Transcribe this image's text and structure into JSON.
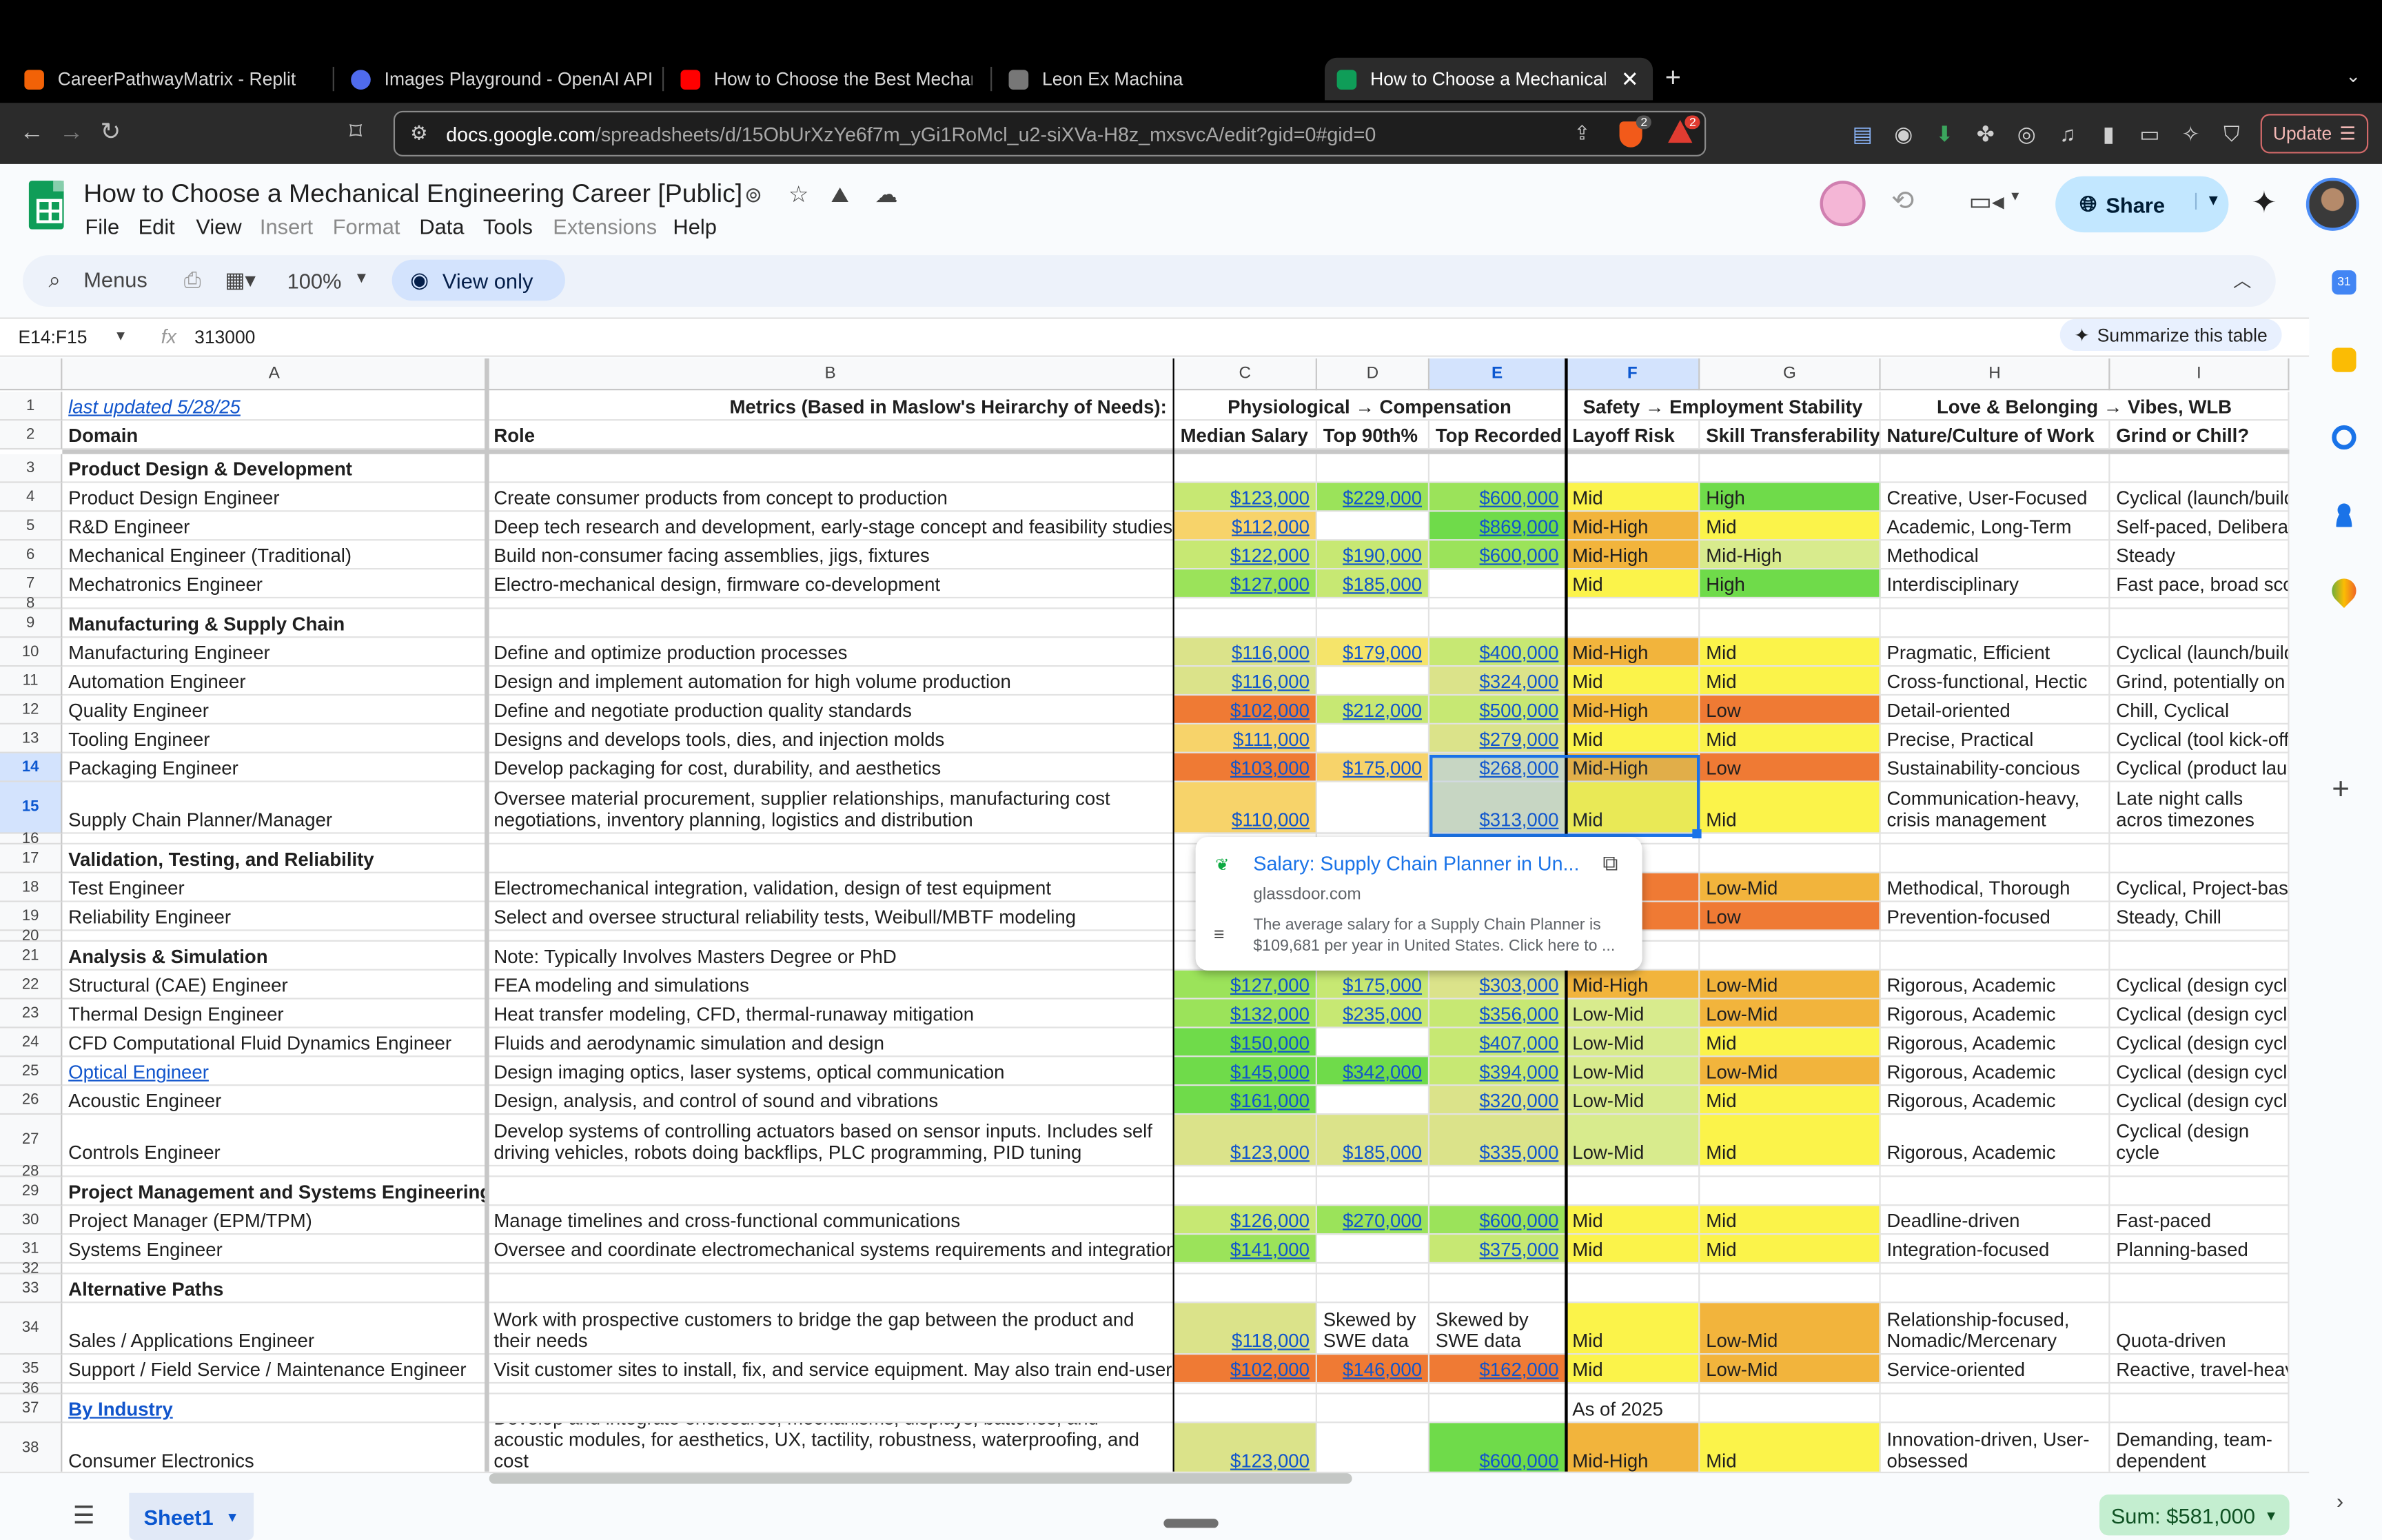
{
  "browser": {
    "tabs": [
      {
        "label": "CareerPathwayMatrix - Replit",
        "color": "#f26207"
      },
      {
        "label": "Images Playground - OpenAI API",
        "color": "#4f6bed"
      },
      {
        "label": "How to Choose the Best Mechani",
        "color": "#ff0000"
      },
      {
        "label": "Leon Ex Machina",
        "color": "#777777"
      },
      {
        "label": "How to Choose a Mechanical",
        "color": "#0f9d58"
      }
    ],
    "new_tab": "+",
    "url_host": "docs.google.com",
    "url_path": "/spreadsheets/d/15ObUrXzYe6f7m_yGi1RoMcl_u2-siXVa-H8z_mxsvcA/edit?gid=0#gid=0",
    "update_label": "Update",
    "shield_badge": "2",
    "alert_badge": "2"
  },
  "sheets": {
    "title": "How to Choose a Mechanical Engineering Career [Public]",
    "menus": [
      "File",
      "Edit",
      "View",
      "Insert",
      "Format",
      "Data",
      "Tools",
      "Extensions",
      "Help"
    ],
    "menus_dim": [
      false,
      false,
      false,
      true,
      true,
      false,
      false,
      true,
      false
    ],
    "share_label": "Share",
    "search_label": "Menus",
    "zoom": "100%",
    "view_only_label": "View only",
    "name_box": "E14:F15",
    "fx": "fx",
    "formula_value": "313000",
    "summarize_label": "Summarize this table",
    "sheet_tab": "Sheet1",
    "sum_label": "Sum: $581,000"
  },
  "columns": [
    "A",
    "B",
    "C",
    "D",
    "E",
    "F",
    "G",
    "H",
    "I"
  ],
  "rows": [
    {
      "n": "1",
      "cells": [
        "last updated 5/28/25",
        "Metrics (Based in Maslow's Heirarchy of Needs):",
        "Physiological → Compensation",
        "",
        "",
        "Safety → Employment Stability",
        "",
        "Love & Belonging → Vibes, WLB",
        ""
      ]
    },
    {
      "n": "2",
      "cells": [
        "Domain",
        "Role",
        "Median Salary",
        "Top 90th%",
        "Top Recorded",
        "Layoff Risk",
        "Skill Transferability",
        "Nature/Culture of Work",
        "Grind or Chill?"
      ]
    },
    {
      "n": "3",
      "cells": [
        "Product Design & Development",
        "",
        "",
        "",
        "",
        "",
        "",
        "",
        ""
      ]
    },
    {
      "n": "4",
      "cells": [
        "Product Design Engineer",
        "Create consumer products from concept to production",
        "$123,000",
        "$229,000",
        "$600,000",
        "Mid",
        "High",
        "Creative, User-Focused",
        "Cyclical (launch/build"
      ]
    },
    {
      "n": "5",
      "cells": [
        "R&D Engineer",
        "Deep tech research and development, early-stage concept and feasibility studies",
        "$112,000",
        "",
        "$869,000",
        "Mid-High",
        "Mid",
        "Academic, Long-Term",
        "Self-paced, Deliberat"
      ]
    },
    {
      "n": "6",
      "cells": [
        "Mechanical Engineer (Traditional)",
        "Build non-consumer facing assemblies, jigs, fixtures",
        "$122,000",
        "$190,000",
        "$600,000",
        "Mid-High",
        "Mid-High",
        "Methodical",
        "Steady"
      ]
    },
    {
      "n": "7",
      "cells": [
        "Mechatronics Engineer",
        "Electro-mechanical design, firmware co-development",
        "$127,000",
        "$185,000",
        "",
        "Mid",
        "High",
        "Interdisciplinary",
        "Fast pace, broad sco"
      ]
    },
    {
      "n": "8",
      "cells": [
        "",
        "",
        "",
        "",
        "",
        "",
        "",
        "",
        ""
      ]
    },
    {
      "n": "9",
      "cells": [
        "Manufacturing & Supply Chain",
        "",
        "",
        "",
        "",
        "",
        "",
        "",
        ""
      ]
    },
    {
      "n": "10",
      "cells": [
        "Manufacturing Engineer",
        "Define and optimize production processes",
        "$116,000",
        "$179,000",
        "$400,000",
        "Mid-High",
        "Mid",
        "Pragmatic, Efficient",
        "Cyclical (launch/build"
      ]
    },
    {
      "n": "11",
      "cells": [
        "Automation Engineer",
        "Design and implement automation for high volume production",
        "$116,000",
        "",
        "$324,000",
        "Mid",
        "Mid",
        "Cross-functional, Hectic",
        "Grind, potentially on c"
      ]
    },
    {
      "n": "12",
      "cells": [
        "Quality Engineer",
        "Define and negotiate production quality standards",
        "$102,000",
        "$212,000",
        "$500,000",
        "Mid-High",
        "Low",
        "Detail-oriented",
        "Chill, Cyclical"
      ]
    },
    {
      "n": "13",
      "cells": [
        "Tooling Engineer",
        "Designs and develops tools, dies, and injection molds",
        "$111,000",
        "",
        "$279,000",
        "Mid",
        "Mid",
        "Precise, Practical",
        "Cyclical (tool kick-off)"
      ]
    },
    {
      "n": "14",
      "cells": [
        "Packaging Engineer",
        "Develop packaging for cost, durability, and aesthetics",
        "$103,000",
        "$175,000",
        "$268,000",
        "Mid-High",
        "Low",
        "Sustainability-concious",
        "Cyclical (product laur"
      ]
    },
    {
      "n": "15",
      "cells": [
        "Supply Chain Planner/Manager",
        "Oversee material procurement, supplier relationships, manufacturing cost negotiations, inventory planning, logistics and distribution",
        "$110,000",
        "",
        "$313,000",
        "Mid",
        "Mid",
        "Communication-heavy, crisis management",
        "Late night calls acros timezones"
      ]
    },
    {
      "n": "16",
      "cells": [
        "",
        "",
        "",
        "",
        "",
        "",
        "",
        "",
        ""
      ]
    },
    {
      "n": "17",
      "cells": [
        "Validation, Testing, and Reliability",
        "",
        "",
        "",
        "",
        "",
        "",
        "",
        ""
      ]
    },
    {
      "n": "18",
      "cells": [
        "Test Engineer",
        "Electromechanical integration, validation, design of test equipment",
        "",
        "",
        "",
        "",
        "Low-Mid",
        "Methodical, Thorough",
        "Cyclical, Project-base"
      ]
    },
    {
      "n": "19",
      "cells": [
        "Reliability Engineer",
        "Select and oversee structural reliability tests, Weibull/MBTF modeling",
        "",
        "",
        "",
        "",
        "Low",
        "Prevention-focused",
        "Steady, Chill"
      ]
    },
    {
      "n": "20",
      "cells": [
        "",
        "",
        "",
        "",
        "",
        "",
        "",
        "",
        ""
      ]
    },
    {
      "n": "21",
      "cells": [
        "Analysis & Simulation",
        "Note: Typically Involves Masters Degree or PhD",
        "",
        "",
        "",
        "",
        "",
        "",
        ""
      ]
    },
    {
      "n": "22",
      "cells": [
        "Structural (CAE) Engineer",
        "FEA modeling and simulations",
        "$127,000",
        "$175,000",
        "$303,000",
        "Mid-High",
        "Low-Mid",
        "Rigorous, Academic",
        "Cyclical (design cycle"
      ]
    },
    {
      "n": "23",
      "cells": [
        "Thermal Design Engineer",
        "Heat transfer modeling, CFD, thermal-runaway mitigation",
        "$132,000",
        "$235,000",
        "$356,000",
        "Low-Mid",
        "Low-Mid",
        "Rigorous, Academic",
        "Cyclical (design cycle"
      ]
    },
    {
      "n": "24",
      "cells": [
        "CFD Computational Fluid Dynamics Engineer",
        "Fluids and aerodynamic simulation and design",
        "$150,000",
        "",
        "$407,000",
        "Low-Mid",
        "Mid",
        "Rigorous, Academic",
        "Cyclical (design cycle"
      ]
    },
    {
      "n": "25",
      "cells": [
        "Optical Engineer",
        "Design imaging optics, laser systems, optical communication",
        "$145,000",
        "$342,000",
        "$394,000",
        "Low-Mid",
        "Low-Mid",
        "Rigorous, Academic",
        "Cyclical (design cycle"
      ]
    },
    {
      "n": "26",
      "cells": [
        "Acoustic Engineer",
        "Design, analysis, and control of sound and vibrations",
        "$161,000",
        "",
        "$320,000",
        "Low-Mid",
        "Mid",
        "Rigorous, Academic",
        "Cyclical (design cycle"
      ]
    },
    {
      "n": "27",
      "cells": [
        "Controls Engineer",
        "Develop systems of controlling actuators based on sensor inputs. Includes self driving vehicles, robots doing backflips, PLC programming, PID tuning",
        "$123,000",
        "$185,000",
        "$335,000",
        "Low-Mid",
        "Mid",
        "Rigorous, Academic",
        "Cyclical (design cycle"
      ]
    },
    {
      "n": "28",
      "cells": [
        "",
        "",
        "",
        "",
        "",
        "",
        "",
        "",
        ""
      ]
    },
    {
      "n": "29",
      "cells": [
        "Project Management and Systems Engineering",
        "",
        "",
        "",
        "",
        "",
        "",
        "",
        ""
      ]
    },
    {
      "n": "30",
      "cells": [
        "Project Manager (EPM/TPM)",
        "Manage timelines and cross-functional communications",
        "$126,000",
        "$270,000",
        "$600,000",
        "Mid",
        "Mid",
        "Deadline-driven",
        "Fast-paced"
      ]
    },
    {
      "n": "31",
      "cells": [
        "Systems Engineer",
        "Oversee and coordinate electromechanical systems requirements and integration",
        "$141,000",
        "",
        "$375,000",
        "Mid",
        "Mid",
        "Integration-focused",
        "Planning-based"
      ]
    },
    {
      "n": "32",
      "cells": [
        "",
        "",
        "",
        "",
        "",
        "",
        "",
        "",
        ""
      ]
    },
    {
      "n": "33",
      "cells": [
        "Alternative Paths",
        "",
        "",
        "",
        "",
        "",
        "",
        "",
        ""
      ]
    },
    {
      "n": "34",
      "cells": [
        "Sales / Applications Engineer",
        "Work with prospective customers to bridge the gap between the product and their needs",
        "$118,000",
        "Skewed by SWE data",
        "Skewed by SWE data",
        "Mid",
        "Low-Mid",
        "Relationship-focused, Nomadic/Mercenary",
        "Quota-driven"
      ]
    },
    {
      "n": "35",
      "cells": [
        "Support / Field Service / Maintenance Engineer",
        "Visit customer sites to install, fix, and service equipment. May also train end-users",
        "$102,000",
        "$146,000",
        "$162,000",
        "Mid",
        "Low-Mid",
        "Service-oriented",
        "Reactive, travel-heav"
      ]
    },
    {
      "n": "36",
      "cells": [
        "",
        "",
        "",
        "",
        "",
        "",
        "",
        "",
        ""
      ]
    },
    {
      "n": "37",
      "cells": [
        "By Industry",
        "",
        "",
        "",
        "",
        "As of 2025",
        "",
        "",
        ""
      ]
    },
    {
      "n": "38",
      "cells": [
        "Consumer Electronics",
        "Develop and integrate enclosures, mechanisms, displays, batteries, and acoustic modules, for aesthetics, UX, tactility, robustness, waterproofing, and cost",
        "$123,000",
        "",
        "$600,000",
        "Mid-High",
        "Mid",
        "Innovation-driven, User-obsessed",
        "Demanding, team-dependent"
      ]
    }
  ],
  "popup": {
    "title": "Salary: Supply Chain Planner in Un...",
    "source": "glassdoor.com",
    "text": "The average salary for a Supply Chain Planner is $109,681 per year in United States. Click here to ..."
  }
}
